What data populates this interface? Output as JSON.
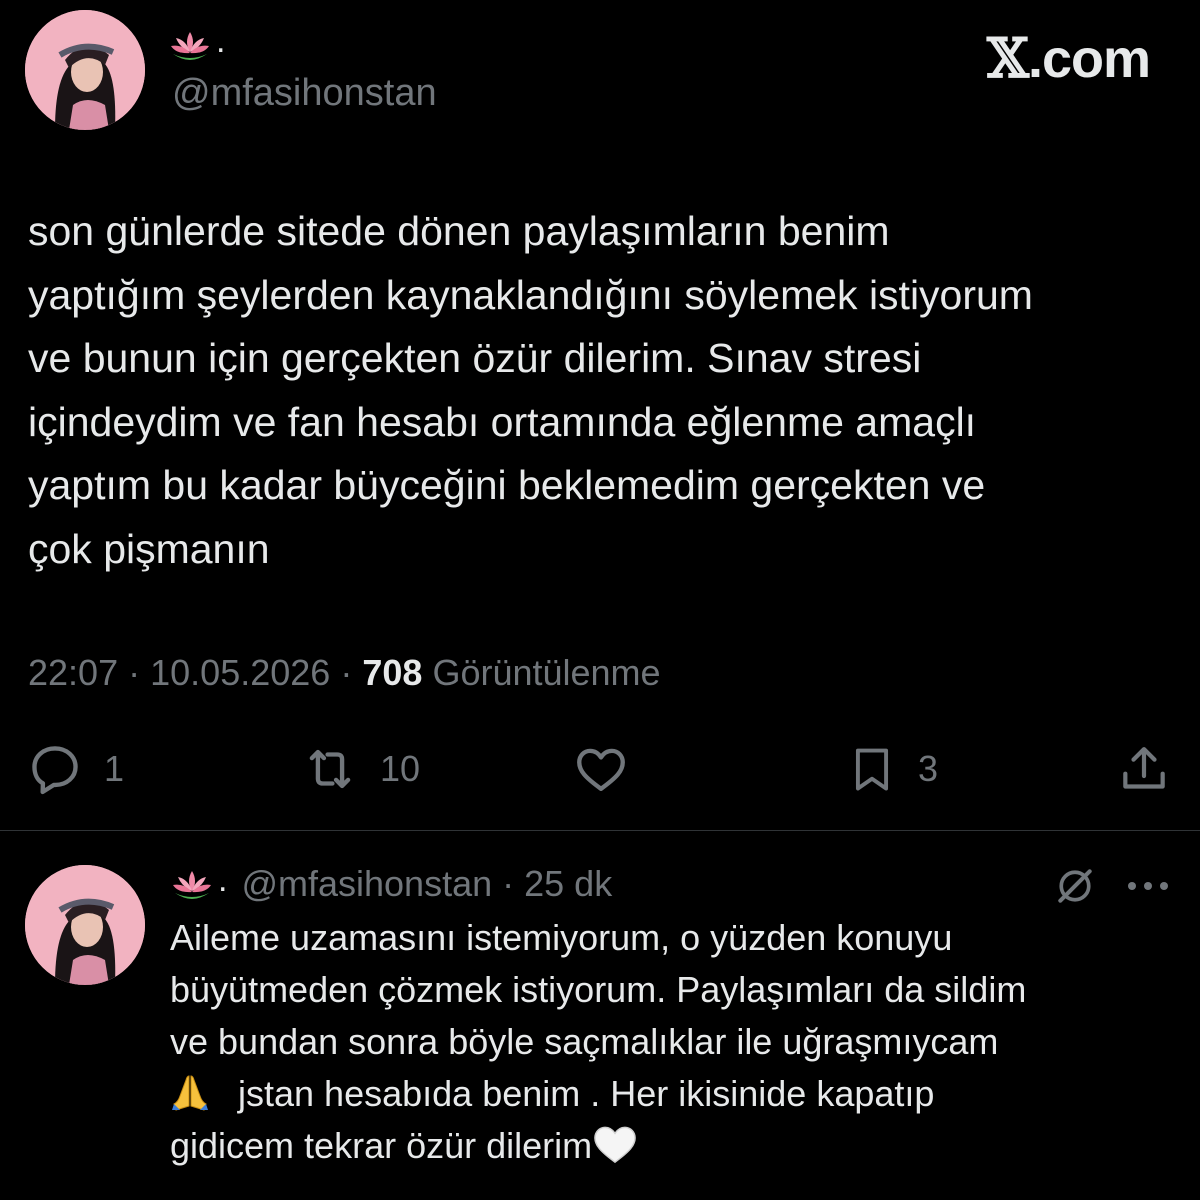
{
  "brand": {
    "text_x": "𝕏",
    "text_rest": ".com"
  },
  "main_tweet": {
    "display_name_suffix": ".",
    "handle": "@mfasihonstan",
    "body_lines": [
      "son günlerde sitede dönen paylaşımların benim",
      "yaptığım şeylerden kaynaklandığını söylemek istiyorum",
      "ve bunun için gerçekten özür dilerim. Sınav stresi",
      "içindeydim ve fan hesabı ortamında eğlenme amaçlı",
      "yaptım bu kadar büyceğini beklemedim gerçekten ve",
      "çok pişmanın"
    ],
    "time": "22:07",
    "date": "10.05.2026",
    "separator": "·",
    "views_count": "708",
    "views_label": "Görüntülenme",
    "actions": {
      "reply_count": "1",
      "retweet_count": "10",
      "bookmark_count": "3"
    }
  },
  "reply_tweet": {
    "display_name_suffix": ".",
    "handle": "@mfasihonstan",
    "separator": "·",
    "time_ago": "25 dk",
    "body_lines": [
      "Aileme uzamasını istemiyorum, o yüzden konuyu",
      "büyütmeden çözmek istiyorum. Paylaşımları da sildim",
      "ve bundan sonra böyle saçmalıklar ile uğraşmıycam",
      "jstan hesabıda benim . Her ikisinide kapatıp",
      "gidicem tekrar özür dilerim"
    ]
  },
  "icons": {
    "lotus": "lotus-icon",
    "reply": "reply-icon",
    "retweet": "retweet-icon",
    "like": "heart-icon",
    "bookmark": "bookmark-icon",
    "share": "share-icon",
    "grok": "grok-icon",
    "more": "more-icon",
    "pray": "folded-hands-emoji",
    "heart": "white-heart-emoji"
  },
  "colors": {
    "background": "#000000",
    "text": "#e7e9ea",
    "muted": "#71767b",
    "divider": "#2f3336",
    "avatar_bg": "#f3b8c4"
  }
}
